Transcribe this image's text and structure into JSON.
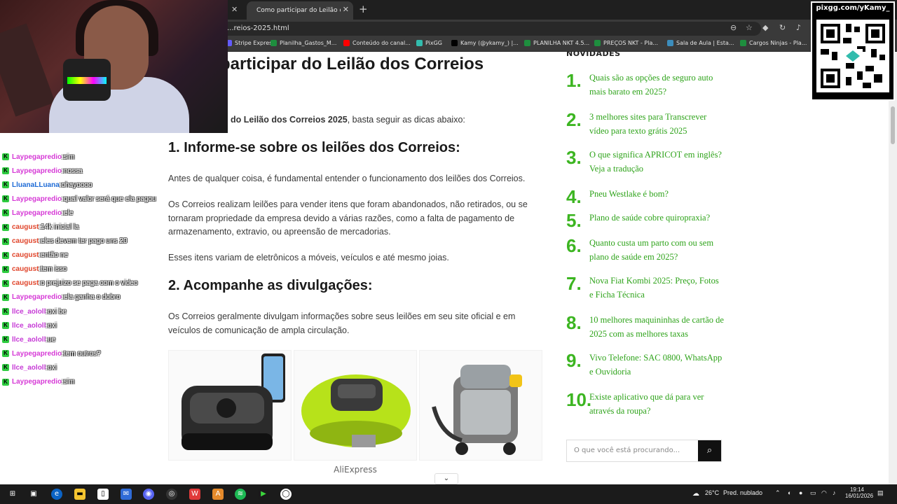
{
  "browser": {
    "tab_title": "Como participar do Leilão dos Correios",
    "url": "...reios-2025.html",
    "bookmarks": [
      {
        "label": "Stripe Express",
        "color": "#635bff"
      },
      {
        "label": "Planilha_Gastos_M...",
        "color": "#1e8e3e"
      },
      {
        "label": "Conteúdo do canal...",
        "color": "#ff0000"
      },
      {
        "label": "PixGG",
        "color": "#32bcad"
      },
      {
        "label": "Kamy (@ykamy_) |...",
        "color": "#000000"
      },
      {
        "label": "PLANILHA NKT 4.5...",
        "color": "#1e8e3e"
      },
      {
        "label": "PREÇOS NKT - Pla...",
        "color": "#1e8e3e"
      },
      {
        "label": "Sala de Aula | Esta...",
        "color": "#3c8dbc"
      },
      {
        "label": "Cargos Ninjas - Pla...",
        "color": "#1e8e3e"
      }
    ]
  },
  "article": {
    "title": "participar do Leilão dos Correios",
    "intro_bold": "do Leilão dos Correios 2025",
    "intro_rest": ", basta seguir as dicas abaixo:",
    "h2_1": "1. Informe-se sobre os leilões dos Correios:",
    "p1": "Antes de qualquer coisa, é fundamental entender o funcionamento dos leilões dos Correios.",
    "p2": "Os Correios realizam leilões para vender itens que foram abandonados, não retirados, ou se tornaram propriedade da empresa devido a várias razões, como a falta de pagamento de armazenamento, extravio, ou apreensão de mercadorias.",
    "p3": "Esses itens variam de eletrônicos a móveis, veículos e até mesmo joias.",
    "h2_2": "2. Acompanhe as divulgações:",
    "p4": "Os Correios geralmente divulgam informações sobre seus leilões em seu site oficial e em veículos de comunicação de ampla circulação.",
    "ad_label": "AliExpress"
  },
  "sidebar": {
    "heading": "NOVIDADES",
    "items": [
      {
        "num": "1.",
        "title": "Quais são as opções de seguro auto mais barato em 2025?"
      },
      {
        "num": "2.",
        "title": "3 melhores sites para Transcrever vídeo para texto grátis 2025"
      },
      {
        "num": "3.",
        "title": "O que significa APRICOT em inglês? Veja a tradução"
      },
      {
        "num": "4.",
        "title": "Pneu Westlake é bom?"
      },
      {
        "num": "5.",
        "title": "Plano de saúde cobre quiropraxia?"
      },
      {
        "num": "6.",
        "title": "Quanto custa um parto com ou sem plano de saúde em 2025?"
      },
      {
        "num": "7.",
        "title": "Nova Fiat Kombi 2025: Preço, Fotos e Ficha Técnica"
      },
      {
        "num": "8.",
        "title": "10 melhores maquininhas de cartão de 2025 com as melhores taxas"
      },
      {
        "num": "9.",
        "title": "Vivo Telefone: SAC 0800, WhatsApp e Ouvidoria"
      },
      {
        "num": "10.",
        "title": "Existe aplicativo que dá para ver através da roupa?"
      }
    ],
    "search_placeholder": "O que você está procurando..."
  },
  "overlay": {
    "qr_label": "pixgg.com/yKamy_",
    "chat": [
      {
        "user": "Laypegapredio",
        "color": "#d63ad6",
        "text": "sim"
      },
      {
        "user": "Laypegapredio",
        "color": "#d63ad6",
        "text": "nossa"
      },
      {
        "user": "LluanaLLuana",
        "color": "#1e6bd6",
        "text": "ohayoooo"
      },
      {
        "user": "Laypegapredio",
        "color": "#d63ad6",
        "text": "qual valor será que ela pagou"
      },
      {
        "user": "Laypegapredio",
        "color": "#d63ad6",
        "text": "ele"
      },
      {
        "user": "caugust",
        "color": "#e0452b",
        "text": "14k inicial la"
      },
      {
        "user": "caugust",
        "color": "#e0452b",
        "text": "eles devem ter pago uns 20"
      },
      {
        "user": "caugust",
        "color": "#e0452b",
        "text": "então ne"
      },
      {
        "user": "caugust",
        "color": "#e0452b",
        "text": "tem isso"
      },
      {
        "user": "caugust",
        "color": "#e0452b",
        "text": "o prejuizo se paga com o video"
      },
      {
        "user": "Laypegapredio",
        "color": "#d63ad6",
        "text": "ela ganha o dobro"
      },
      {
        "user": "llce_aololl",
        "color": "#c63ad6",
        "text": "oxi be"
      },
      {
        "user": "llce_aololl",
        "color": "#c63ad6",
        "text": "oxi"
      },
      {
        "user": "llce_aololl",
        "color": "#c63ad6",
        "text": "ue"
      },
      {
        "user": "Laypegapredio",
        "color": "#d63ad6",
        "text": "tem outros?"
      },
      {
        "user": "llce_aololl",
        "color": "#c63ad6",
        "text": "oxi"
      },
      {
        "user": "Laypegapredio",
        "color": "#d63ad6",
        "text": "sim"
      }
    ]
  },
  "taskbar": {
    "weather": "26°C",
    "weather_desc": "Pred. nublado",
    "time": "19:14",
    "date": "16/01/2026"
  }
}
